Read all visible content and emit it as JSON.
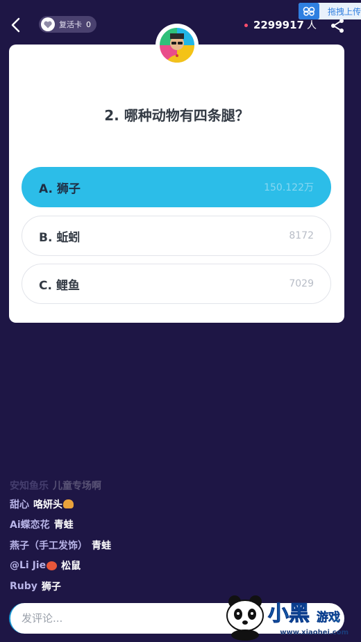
{
  "header": {
    "revive_card_label": "复活卡",
    "revive_card_count": "0",
    "online_count": "2299917",
    "online_unit": "人",
    "upload_badge": "拖拽上传"
  },
  "question": {
    "title": "2. 哪种动物有四条腿？",
    "options": [
      {
        "label": "A. 狮子",
        "votes": "150.122万",
        "selected": true
      },
      {
        "label": "B. 蚯蚓",
        "votes": "8172",
        "selected": false
      },
      {
        "label": "C. 鲤鱼",
        "votes": "7029",
        "selected": false
      }
    ]
  },
  "comments": [
    {
      "user": "安知鱼乐",
      "text": "儿童专场啊"
    },
    {
      "user": "甜心",
      "text": "咯妍头"
    },
    {
      "user": "Ai蝶恋花",
      "text": "青蛙"
    },
    {
      "user": "燕子（手工发饰）",
      "text": "青蛙"
    },
    {
      "user": "@Li Jie",
      "text": "松鼠"
    },
    {
      "user": "Ruby",
      "text": "狮子"
    }
  ],
  "input": {
    "placeholder": "发评论..."
  },
  "watermark": {
    "brand": "小黑",
    "sub": "游戏",
    "url": "www.xiaohei.com"
  },
  "colors": {
    "background": "#1e1645",
    "accent": "#2cbde8",
    "card": "#ffffff"
  }
}
